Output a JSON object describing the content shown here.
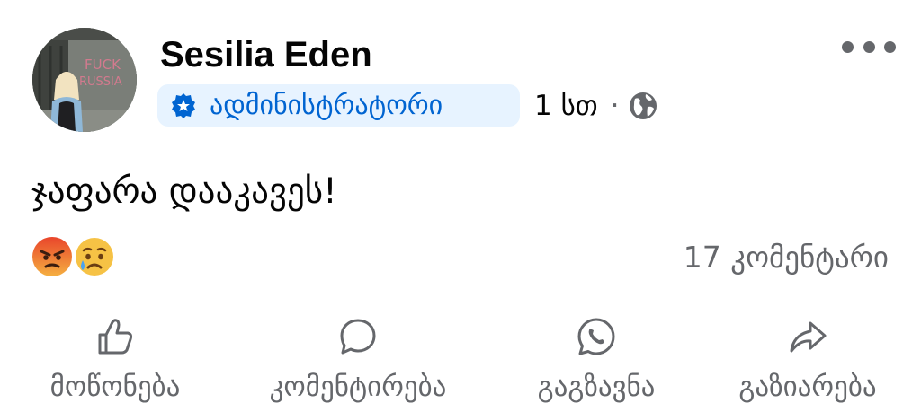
{
  "post": {
    "author": "Sesilia Eden",
    "role_badge": "ადმინისტრატორი",
    "time": "1 სთ",
    "separator": "·",
    "text": "ჯაფარა დააკავეს!",
    "avatar_wall_text": "FUCK RUSSIA",
    "reactions": [
      "angry-reaction-icon",
      "sad-reaction-icon"
    ],
    "comment_count": "17 კომენტარი"
  },
  "actions": [
    {
      "label": "მოწონება",
      "icon": "like-icon"
    },
    {
      "label": "კომენტირება",
      "icon": "comment-icon"
    },
    {
      "label": "გაგზავნა",
      "icon": "whatsapp-icon"
    },
    {
      "label": "გაზიარება",
      "icon": "share-icon"
    }
  ],
  "colors": {
    "badge_bg": "#e7f3ff",
    "badge_text": "#0064d1",
    "secondary_text": "#65676b"
  }
}
